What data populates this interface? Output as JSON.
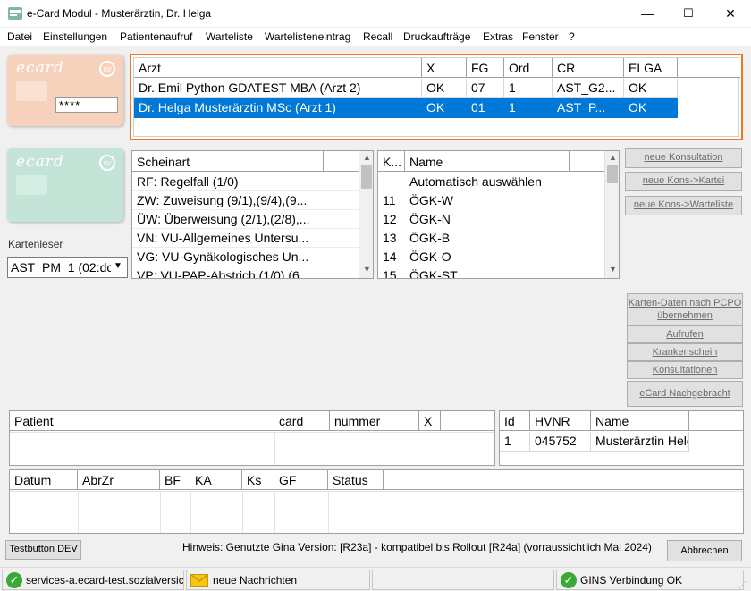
{
  "window": {
    "title": "e-Card Modul - Musterärztin, Dr. Helga",
    "minimize": "—",
    "maximize": "☐",
    "close": "✕"
  },
  "menu": [
    "Datei",
    "Einstellungen",
    "Patientenaufruf",
    "Warteliste",
    "Wartelisteneintrag",
    "Recall",
    "Druckaufträge",
    "Extras",
    "Fenster",
    "?"
  ],
  "card1": {
    "logo": "ecard",
    "pin": "****"
  },
  "card2": {
    "logo": "ecard"
  },
  "kartenleser": {
    "label": "Kartenleser",
    "value": "AST_PM_1 (02:do"
  },
  "arzt_table": {
    "columns": [
      "Arzt",
      "X",
      "FG",
      "Ord",
      "CR",
      "ELGA"
    ],
    "rows": [
      {
        "arzt": "Dr. Emil Python GDATEST MBA (Arzt 2)",
        "x": "OK",
        "fg": "07",
        "ord": "1",
        "cr": "AST_G2...",
        "elga": "OK",
        "selected": false
      },
      {
        "arzt": "Dr. Helga Musterärztin MSc (Arzt 1)",
        "x": "OK",
        "fg": "01",
        "ord": "1",
        "cr": "AST_P...",
        "elga": "OK",
        "selected": true
      }
    ]
  },
  "scheinart": {
    "header": "Scheinart",
    "items": [
      "RF: Regelfall (1/0)",
      "ZW: Zuweisung (9/1),(9/4),(9...",
      "ÜW: Überweisung (2/1),(2/8),...",
      "VN: VU-Allgemeines Untersu...",
      "VG: VU-Gynäkologisches Un...",
      "VP: VU-PAP-Abstrich (1/0) (6..."
    ]
  },
  "kasse": {
    "columns": [
      "K...",
      "Name"
    ],
    "rows": [
      {
        "k": "",
        "name": "Automatisch auswählen"
      },
      {
        "k": "11",
        "name": "ÖGK-W"
      },
      {
        "k": "12",
        "name": "ÖGK-N"
      },
      {
        "k": "13",
        "name": "ÖGK-B"
      },
      {
        "k": "14",
        "name": "ÖGK-O"
      },
      {
        "k": "15",
        "name": "ÖGK-ST"
      }
    ]
  },
  "buttons_top": [
    "neue Konsultation",
    "neue Kons->Kartei",
    "neue Kons->Warteliste"
  ],
  "buttons_mid": {
    "karten_daten": [
      "Karten-Daten nach PCPO",
      "übernehmen"
    ],
    "aufrufen": "Aufrufen",
    "krankenschein": "Krankenschein",
    "konsultationen": "Konsultationen",
    "nachgebracht": "eCard Nachgebracht"
  },
  "patient_table": {
    "columns": [
      "Patient",
      "card",
      "nummer",
      "X"
    ]
  },
  "hvnr_table": {
    "columns": [
      "Id",
      "HVNR",
      "Name"
    ],
    "rows": [
      {
        "id": "1",
        "hvnr": "045752",
        "name": "Musterärztin Helga"
      }
    ]
  },
  "datum_table": {
    "columns": [
      "Datum",
      "AbrZr",
      "BF",
      "KA",
      "Ks",
      "GF",
      "Status"
    ]
  },
  "testbutton": "Testbutton DEV",
  "hinweis": "Hinweis: Genutzte Gina Version: [R23a] - kompatibel bis Rollout [R24a] (vorraussichtlich Mai 2024)",
  "abbrechen": "Abbrechen",
  "status": {
    "service": "services-a.ecard-test.sozialversich",
    "nachrichten": "neue Nachrichten",
    "gins": "GINS Verbindung OK"
  },
  "colors": {
    "selection": "#0078d7",
    "focus_border": "#f07820",
    "ok_green": "#3aa935",
    "card1_bg": "#f6d2bd",
    "card2_bg": "#c3e4d7"
  }
}
